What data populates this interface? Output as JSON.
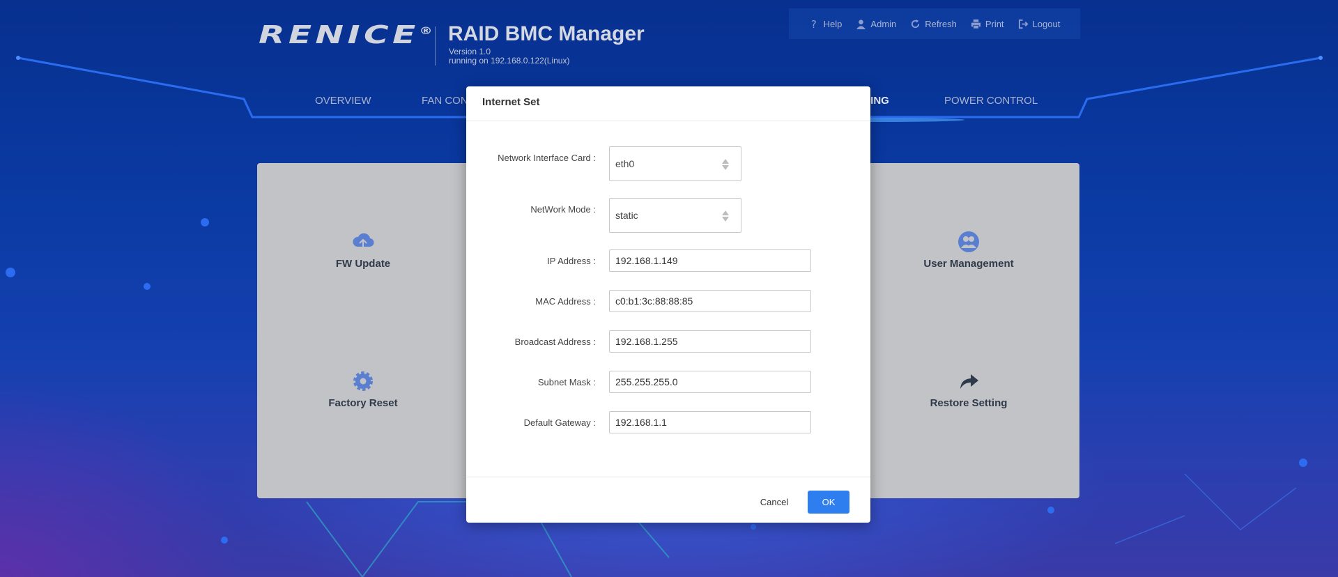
{
  "header": {
    "logo_text": "RENICE",
    "logo_mark": "®",
    "app_title": "RAID BMC Manager",
    "version": "Version 1.0",
    "running_on": "running on 192.168.0.122(Linux)"
  },
  "topbar": {
    "items": [
      {
        "label": "Help",
        "icon": "help-icon"
      },
      {
        "label": "Admin",
        "icon": "user-icon"
      },
      {
        "label": "Refresh",
        "icon": "refresh-icon"
      },
      {
        "label": "Print",
        "icon": "print-icon"
      },
      {
        "label": "Logout",
        "icon": "logout-icon"
      }
    ]
  },
  "nav": {
    "overview": "OVERVIEW",
    "fan_partial": "FAN CON",
    "setting_partial": "TING",
    "power": "POWER CONTROL"
  },
  "tiles": {
    "fw_update": "FW Update",
    "user_management": "User Management",
    "factory_reset": "Factory Reset",
    "restore_setting": "Restore Setting"
  },
  "modal": {
    "title": "Internet Set",
    "fields": {
      "nic": {
        "label": "Network Interface Card :",
        "value": "eth0"
      },
      "mode": {
        "label": "NetWork Mode :",
        "value": "static"
      },
      "ip": {
        "label": "IP Address :",
        "value": "192.168.1.149"
      },
      "mac": {
        "label": "MAC Address :",
        "value": "c0:b1:3c:88:88:85"
      },
      "broadcast": {
        "label": "Broadcast Address :",
        "value": "192.168.1.255"
      },
      "subnet": {
        "label": "Subnet Mask :",
        "value": "255.255.255.0"
      },
      "gateway": {
        "label": "Default Gateway :",
        "value": "192.168.1.1"
      }
    },
    "cancel_label": "Cancel",
    "ok_label": "OK"
  },
  "colors": {
    "accent": "#2f7ef0",
    "background": "#0a3aa3",
    "tile_icon": "#5a7fd0"
  }
}
